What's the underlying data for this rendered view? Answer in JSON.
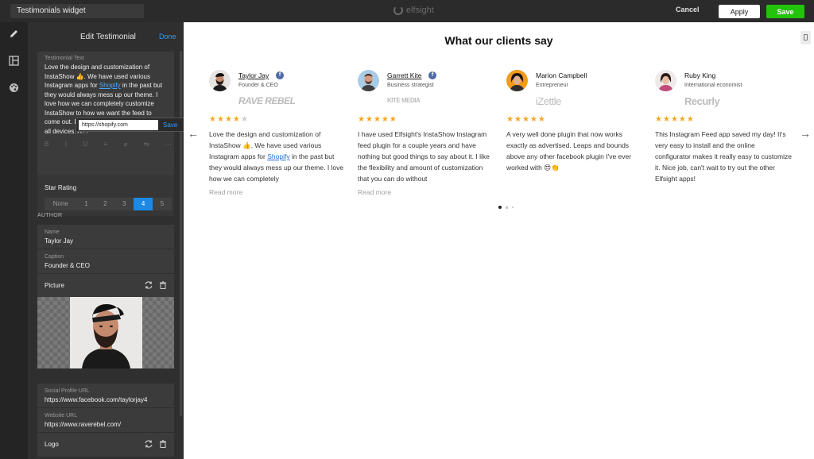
{
  "topbar": {
    "widget_title": "Testimonials widget",
    "brand": "elfsight",
    "cancel_label": "Cancel",
    "apply_label": "Apply",
    "save_label": "Save"
  },
  "panel": {
    "title": "Edit Testimonial",
    "done_label": "Done",
    "testimonial_text_label": "Testimonial Text",
    "testimonial_text_before_link": "Love the design and customization of InstaShow 👍. We have used various Instagram apps for ",
    "testimonial_text_link": "Shopify",
    "testimonial_text_after_link": " in the past but they would always mess up our theme. I love how we can completely customize InstaShow to how we want the feed to come out. Loads quickly and responsive to all devices. A++",
    "link_url": "https://shopify.com",
    "link_save_label": "Save",
    "toolbar": [
      "B",
      "I",
      "U",
      "≡",
      "⌀",
      "⇆",
      "⋯"
    ],
    "star_rating_label": "Star Rating",
    "rating_options": [
      "None",
      "1",
      "2",
      "3",
      "4",
      "5"
    ],
    "rating_selected": "4",
    "author_section": "AUTHOR",
    "name_label": "Name",
    "name_value": "Taylor Jay",
    "caption_label": "Caption",
    "caption_value": "Founder & CEO",
    "picture_label": "Picture",
    "social_label": "Social Profile URL",
    "social_value": "https://www.facebook.com/taylorjay4",
    "website_label": "Website URL",
    "website_value": "https://www.raverebel.com/",
    "logo_label": "Logo"
  },
  "preview": {
    "title": "What our clients say",
    "read_more": "Read more",
    "cards": [
      {
        "name": "Taylor Jay",
        "caption": "Founder & CEO",
        "company": "RAVE REBEL",
        "rating": 4,
        "text_before": "Love the design and customization of InstaShow 👍. We have used various Instagram apps for ",
        "link": "Shopify",
        "text_after": " in the past but they would always mess up our theme. I love how we can completely"
      },
      {
        "name": "Garrett Kite",
        "caption": "Business strategist",
        "company": "KITE MEDIA",
        "rating": 5,
        "text": "I have used Elfsight's InstaShow Instagram feed plugin for a couple years and have nothing but good things to say about it. I like the flexibility and amount of customization that you can do without"
      },
      {
        "name": "Marion Campbell",
        "caption": "Entrepreneur",
        "company": "iZettle",
        "rating": 5,
        "text": "A very well done plugin that now works exactly as advertised. Leaps and bounds above any other facebook plugin I've ever worked with 😍👏"
      },
      {
        "name": "Ruby King",
        "caption": "International economist",
        "company": "Recurly",
        "rating": 5,
        "text": "This Instagram Feed app saved my day! It's very easy to install and the online configurator makes it really easy to customize it. Nice job, can't wait to try out the other Elfsight apps!"
      }
    ]
  },
  "colors": {
    "accent": "#1e88e5",
    "save_green": "#22c30a",
    "star": "#f5a623"
  }
}
